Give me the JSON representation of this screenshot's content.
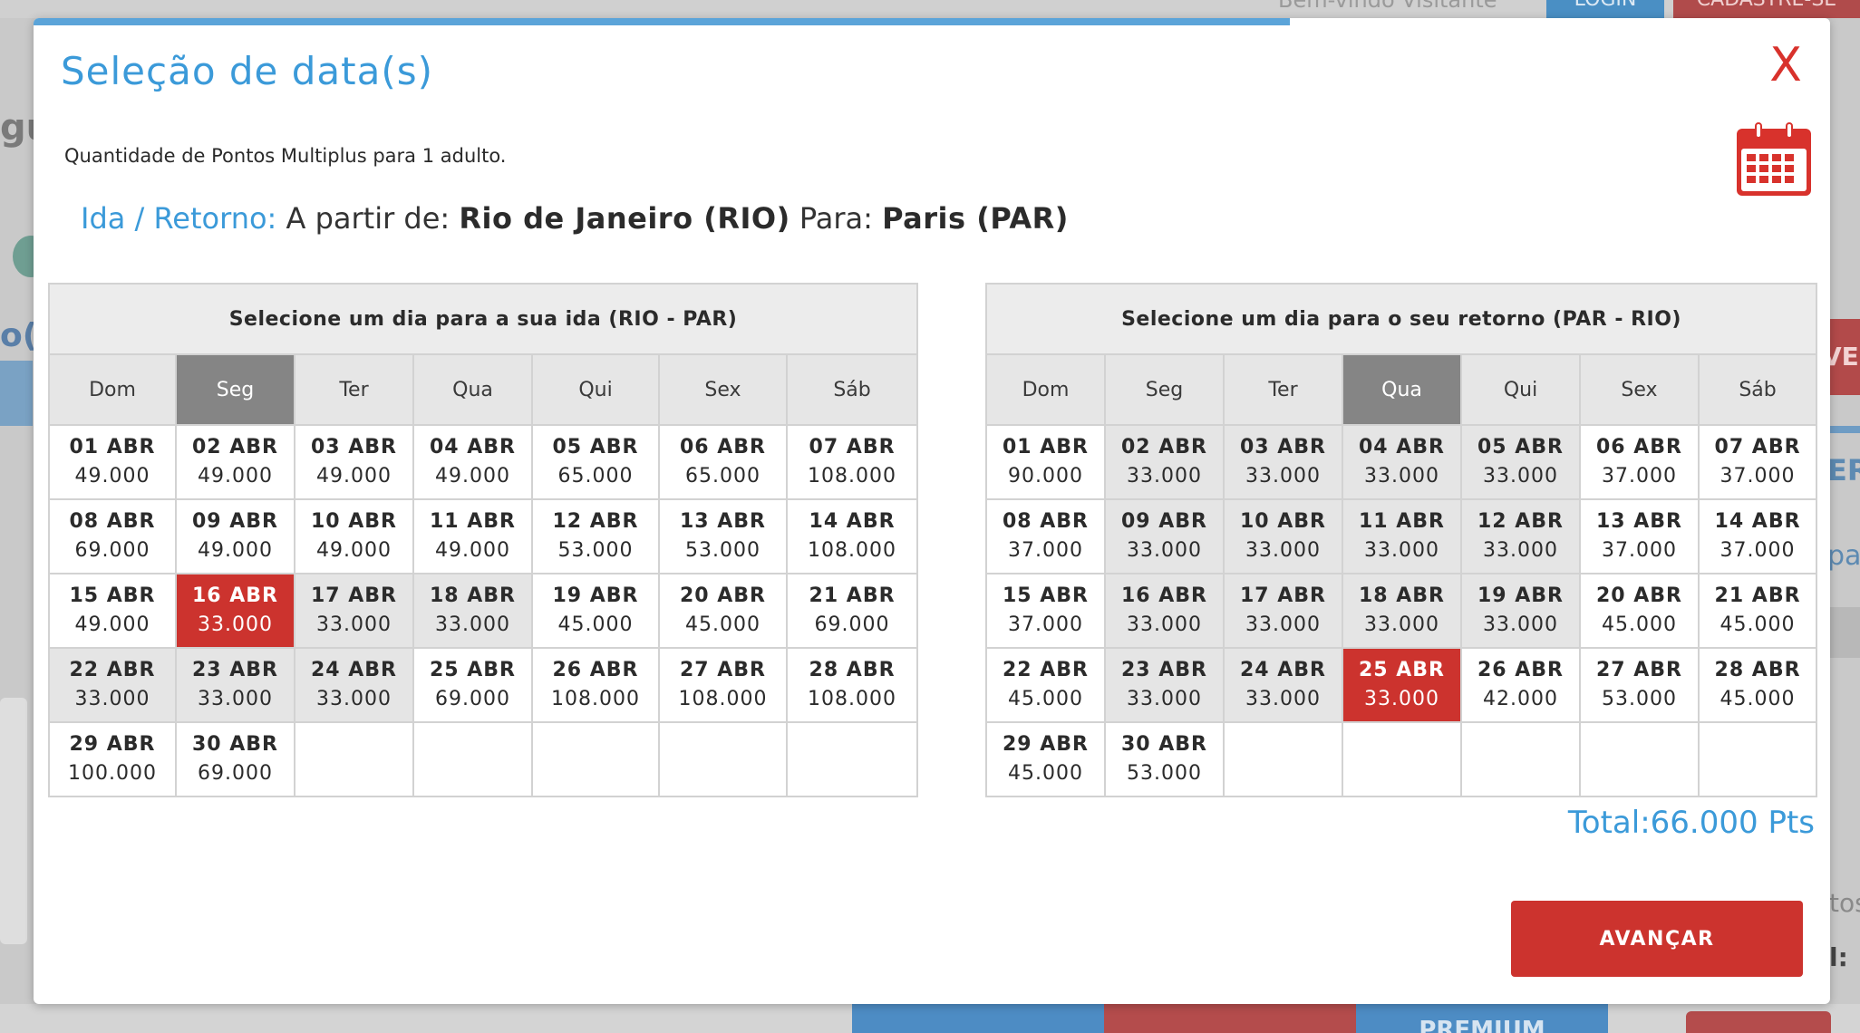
{
  "background": {
    "welcome": "Bem-vindo Visitante",
    "login": "LOGIN",
    "signup": "CADASTRE-SE",
    "left_fragment_1": "gu",
    "left_fragment_2": "o(",
    "right_fragment_1": "VE",
    "right_fragment_2": "ER",
    "right_fragment_3": "pa",
    "right_fragment_4": "tos",
    "right_fragment_5": "l:",
    "bottom_tab": "PREMIUM"
  },
  "modal": {
    "title": "Seleção de data(s)",
    "close_label": "X",
    "subtitle": "Quantidade de Pontos Multiplus para 1 adulto.",
    "route": {
      "label": "Ida / Retorno:",
      "from_label": "A partir de:",
      "from_city": "Rio de Janeiro (RIO)",
      "to_label": "Para:",
      "to_city": "Paris (PAR)"
    },
    "calendar_icon": "calendar-icon",
    "total": "Total:66.000 Pts",
    "advance_label": "AVANÇAR",
    "colors": {
      "accent": "#3b9ad9",
      "selected": "#cc332e",
      "cheap": "#e5e5e5",
      "weekday_selected": "#858585"
    }
  },
  "outbound": {
    "caption": "Selecione um dia para a sua ida (RIO - PAR)",
    "weekdays": [
      "Dom",
      "Seg",
      "Ter",
      "Qua",
      "Qui",
      "Sex",
      "Sáb"
    ],
    "selected_weekday": 1,
    "weeks": [
      [
        {
          "d": "01 ABR",
          "p": "49.000"
        },
        {
          "d": "02 ABR",
          "p": "49.000"
        },
        {
          "d": "03 ABR",
          "p": "49.000"
        },
        {
          "d": "04 ABR",
          "p": "49.000"
        },
        {
          "d": "05 ABR",
          "p": "65.000"
        },
        {
          "d": "06 ABR",
          "p": "65.000"
        },
        {
          "d": "07 ABR",
          "p": "108.000"
        }
      ],
      [
        {
          "d": "08 ABR",
          "p": "69.000"
        },
        {
          "d": "09 ABR",
          "p": "49.000"
        },
        {
          "d": "10 ABR",
          "p": "49.000"
        },
        {
          "d": "11 ABR",
          "p": "49.000"
        },
        {
          "d": "12 ABR",
          "p": "53.000"
        },
        {
          "d": "13 ABR",
          "p": "53.000"
        },
        {
          "d": "14 ABR",
          "p": "108.000"
        }
      ],
      [
        {
          "d": "15 ABR",
          "p": "49.000"
        },
        {
          "d": "16 ABR",
          "p": "33.000",
          "state": "selected"
        },
        {
          "d": "17 ABR",
          "p": "33.000",
          "state": "cheap"
        },
        {
          "d": "18 ABR",
          "p": "33.000",
          "state": "cheap"
        },
        {
          "d": "19 ABR",
          "p": "45.000"
        },
        {
          "d": "20 ABR",
          "p": "45.000"
        },
        {
          "d": "21 ABR",
          "p": "69.000"
        }
      ],
      [
        {
          "d": "22 ABR",
          "p": "33.000",
          "state": "cheap"
        },
        {
          "d": "23 ABR",
          "p": "33.000",
          "state": "cheap"
        },
        {
          "d": "24 ABR",
          "p": "33.000",
          "state": "cheap"
        },
        {
          "d": "25 ABR",
          "p": "69.000"
        },
        {
          "d": "26 ABR",
          "p": "108.000"
        },
        {
          "d": "27 ABR",
          "p": "108.000"
        },
        {
          "d": "28 ABR",
          "p": "108.000"
        }
      ],
      [
        {
          "d": "29 ABR",
          "p": "100.000"
        },
        {
          "d": "30 ABR",
          "p": "69.000"
        },
        null,
        null,
        null,
        null,
        null
      ]
    ]
  },
  "return": {
    "caption": "Selecione um dia para o seu retorno (PAR - RIO)",
    "weekdays": [
      "Dom",
      "Seg",
      "Ter",
      "Qua",
      "Qui",
      "Sex",
      "Sáb"
    ],
    "selected_weekday": 3,
    "weeks": [
      [
        {
          "d": "01 ABR",
          "p": "90.000"
        },
        {
          "d": "02 ABR",
          "p": "33.000",
          "state": "cheap"
        },
        {
          "d": "03 ABR",
          "p": "33.000",
          "state": "cheap"
        },
        {
          "d": "04 ABR",
          "p": "33.000",
          "state": "cheap"
        },
        {
          "d": "05 ABR",
          "p": "33.000",
          "state": "cheap"
        },
        {
          "d": "06 ABR",
          "p": "37.000"
        },
        {
          "d": "07 ABR",
          "p": "37.000"
        }
      ],
      [
        {
          "d": "08 ABR",
          "p": "37.000"
        },
        {
          "d": "09 ABR",
          "p": "33.000",
          "state": "cheap"
        },
        {
          "d": "10 ABR",
          "p": "33.000",
          "state": "cheap"
        },
        {
          "d": "11 ABR",
          "p": "33.000",
          "state": "cheap"
        },
        {
          "d": "12 ABR",
          "p": "33.000",
          "state": "cheap"
        },
        {
          "d": "13 ABR",
          "p": "37.000"
        },
        {
          "d": "14 ABR",
          "p": "37.000"
        }
      ],
      [
        {
          "d": "15 ABR",
          "p": "37.000"
        },
        {
          "d": "16 ABR",
          "p": "33.000",
          "state": "cheap"
        },
        {
          "d": "17 ABR",
          "p": "33.000",
          "state": "cheap"
        },
        {
          "d": "18 ABR",
          "p": "33.000",
          "state": "cheap"
        },
        {
          "d": "19 ABR",
          "p": "33.000",
          "state": "cheap"
        },
        {
          "d": "20 ABR",
          "p": "45.000"
        },
        {
          "d": "21 ABR",
          "p": "45.000"
        }
      ],
      [
        {
          "d": "22 ABR",
          "p": "45.000"
        },
        {
          "d": "23 ABR",
          "p": "33.000",
          "state": "cheap"
        },
        {
          "d": "24 ABR",
          "p": "33.000",
          "state": "cheap"
        },
        {
          "d": "25 ABR",
          "p": "33.000",
          "state": "selected"
        },
        {
          "d": "26 ABR",
          "p": "42.000"
        },
        {
          "d": "27 ABR",
          "p": "53.000"
        },
        {
          "d": "28 ABR",
          "p": "45.000"
        }
      ],
      [
        {
          "d": "29 ABR",
          "p": "45.000"
        },
        {
          "d": "30 ABR",
          "p": "53.000"
        },
        null,
        null,
        null,
        null,
        null
      ]
    ]
  }
}
